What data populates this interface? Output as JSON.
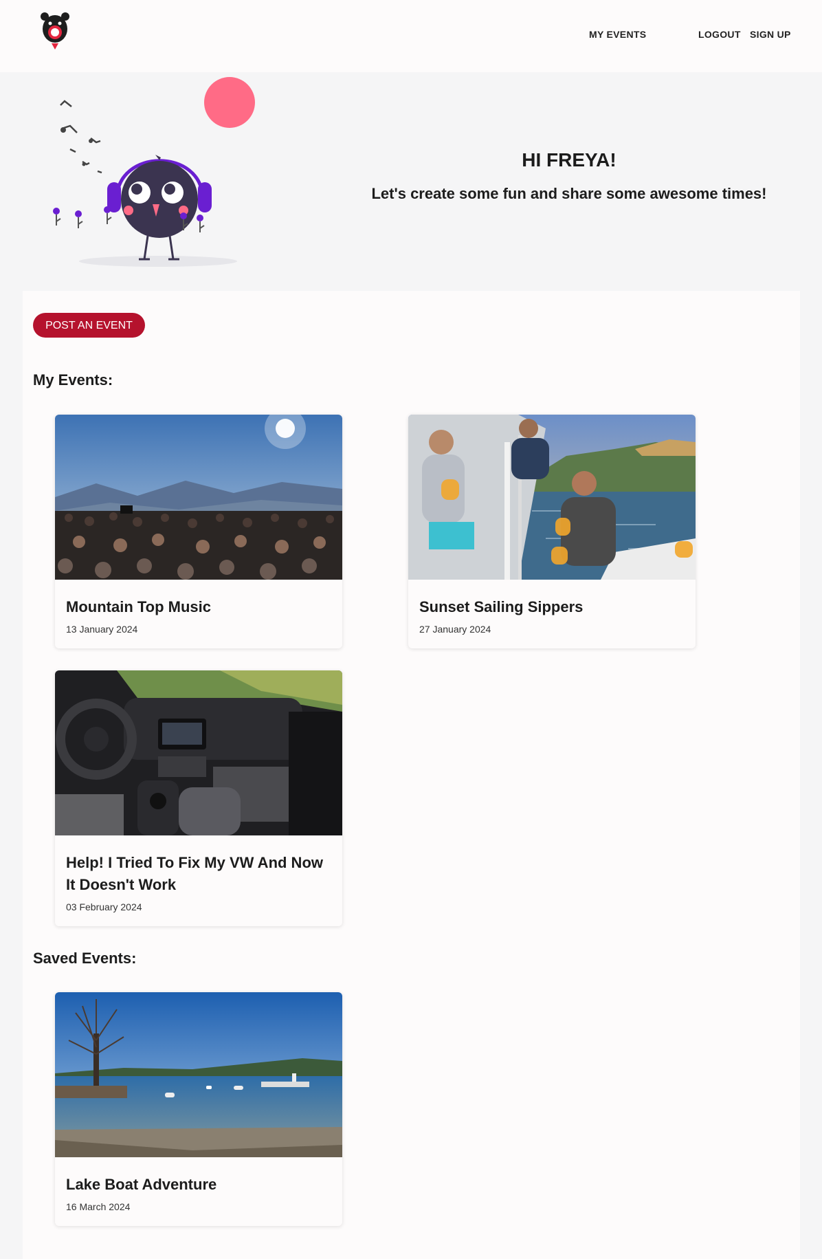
{
  "header": {
    "nav": {
      "my_events": "MY EVENTS",
      "logout": "LOGOUT",
      "sign_up": "SIGN UP"
    }
  },
  "hero": {
    "greeting": "HI FREYA!",
    "tagline": "Let's create some fun and share some awesome times!"
  },
  "main": {
    "post_button": "POST AN EVENT",
    "my_events_title": "My Events:",
    "saved_events_title": "Saved Events:",
    "my_events": [
      {
        "title": "Mountain Top Music",
        "date": "13 January 2024"
      },
      {
        "title": "Sunset Sailing Sippers",
        "date": "27 January 2024"
      },
      {
        "title": "Help! I Tried To Fix My VW And Now It Doesn't Work",
        "date": "03 February 2024"
      }
    ],
    "saved_events": [
      {
        "title": "Lake Boat Adventure",
        "date": "16 March 2024"
      }
    ]
  },
  "colors": {
    "brand": "#b5122d",
    "accent_pink": "#ff6b86",
    "headphones": "#6a1fd1",
    "bird_body": "#3b3450"
  }
}
